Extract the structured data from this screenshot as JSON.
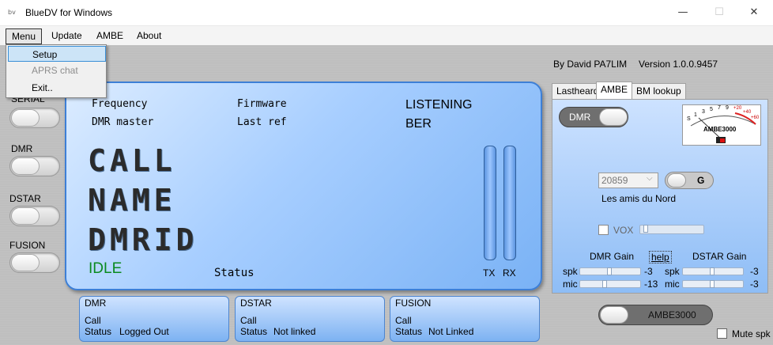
{
  "window": {
    "icon_text": "bv",
    "title": "BlueDV for Windows",
    "min_glyph": "—",
    "max_glyph": "☐",
    "close_glyph": "✕"
  },
  "menubar": {
    "items": [
      "Menu",
      "Update",
      "AMBE",
      "About"
    ],
    "dropdown": [
      "Setup",
      "APRS chat",
      "Exit.."
    ]
  },
  "header": {
    "author": "By David PA7LIM",
    "version": "Version 1.0.0.9457"
  },
  "sidebar": {
    "serial": "SERIAL",
    "dmr": "DMR",
    "dstar": "DSTAR",
    "fusion": "FUSION"
  },
  "display": {
    "frequency": "Frequency",
    "firmware": "Firmware",
    "dmr_master": "DMR master",
    "last_ref": "Last ref",
    "listening": "LISTENING",
    "ber": "BER",
    "call": "CALL",
    "name": "NAME",
    "dmrid": "DMRID",
    "idle": "IDLE",
    "status": "Status",
    "tx": "TX",
    "rx": "RX"
  },
  "panels": {
    "dmr": {
      "title": "DMR",
      "call": "Call",
      "status_label": "Status",
      "status_value": "Logged Out"
    },
    "dstar": {
      "title": "DSTAR",
      "call": "Call",
      "status_label": "Status",
      "status_value": "Not linked"
    },
    "fusion": {
      "title": "FUSION",
      "call": "Call",
      "status_label": "Status",
      "status_value": "Not Linked"
    }
  },
  "tabs": {
    "items": [
      "Lastheard",
      "AMBE",
      "BM lookup"
    ],
    "active": "AMBE"
  },
  "ambe": {
    "dmr_toggle": "DMR",
    "meter_label": "AMBE3000",
    "meter_scale": [
      "S",
      "1",
      "3",
      "5",
      "7",
      "9",
      "+20",
      "+40",
      "+60"
    ],
    "talkgroup": "20859",
    "g_button": "G",
    "talkgroup_name": "Les amis du Nord",
    "vox": "VOX",
    "dmr_gain": "DMR Gain",
    "help": "help",
    "dstar_gain": "DSTAR Gain",
    "spk": "spk",
    "mic": "mic",
    "dmr_spk_value": "-3",
    "dmr_mic_value": "-13",
    "dstar_spk_value": "-3",
    "dstar_mic_value": "-3",
    "ambe_button": "AMBE3000",
    "mute": "Mute spk"
  },
  "colors": {
    "display_bg": "#a7ceff",
    "idle_green": "#0a8a1f"
  }
}
